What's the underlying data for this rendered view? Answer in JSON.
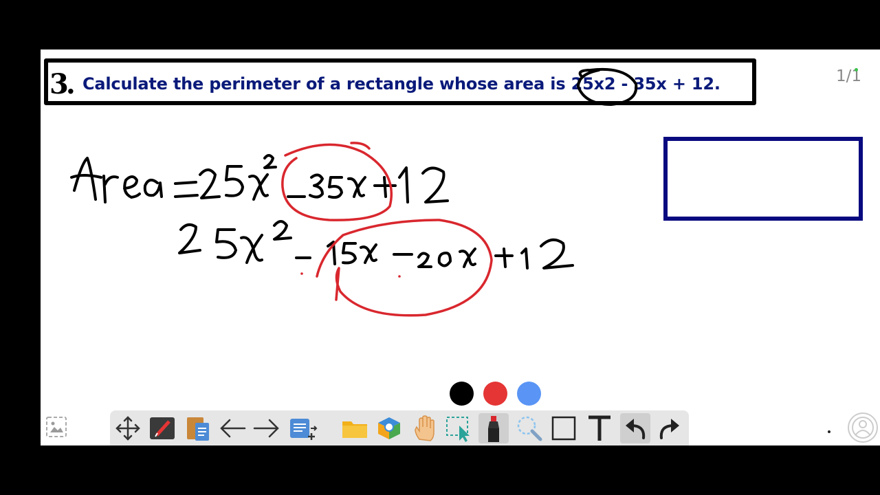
{
  "question": {
    "number": "3.",
    "text": "Calculate the perimeter of a rectangle whose area is 25x2 - 35x + 12."
  },
  "page_counter": "1/1",
  "handwriting": {
    "line1": "Area = 25x² - 35x + 12",
    "line2": "25x² - 15x - 20x + 12"
  },
  "palette": [
    {
      "name": "black",
      "color": "#000000"
    },
    {
      "name": "red",
      "color": "#e53535"
    },
    {
      "name": "blue",
      "color": "#5a95f5"
    }
  ],
  "toolbar": {
    "tools": [
      {
        "name": "move-tool",
        "icon": "move-arrows-icon"
      },
      {
        "name": "whiteboard-tool",
        "icon": "board-pen-icon"
      },
      {
        "name": "notes-tool",
        "icon": "clipboard-doc-icon"
      },
      {
        "name": "previous-page",
        "icon": "arrow-left-icon"
      },
      {
        "name": "next-page",
        "icon": "arrow-right-icon"
      },
      {
        "name": "add-page",
        "icon": "doc-add-icon"
      },
      {
        "name": "open-folder",
        "icon": "folder-icon"
      },
      {
        "name": "resources-tool",
        "icon": "boxes-icon"
      },
      {
        "name": "hand-tool",
        "icon": "hand-icon"
      },
      {
        "name": "select-tool",
        "icon": "dashed-select-icon"
      },
      {
        "name": "marker-tool",
        "icon": "marker-icon",
        "active": true
      },
      {
        "name": "eraser-tool",
        "icon": "lasso-eraser-icon"
      },
      {
        "name": "rectangle-tool",
        "icon": "square-icon"
      },
      {
        "name": "text-tool",
        "icon": "text-t-icon"
      },
      {
        "name": "undo-tool",
        "icon": "undo-icon",
        "active": true
      },
      {
        "name": "redo-tool",
        "icon": "redo-icon"
      }
    ]
  },
  "colors": {
    "ink": "#000000",
    "annotation": "#d9272e",
    "question_text": "#0a1a7a",
    "rectangle": "#0a0a80"
  }
}
